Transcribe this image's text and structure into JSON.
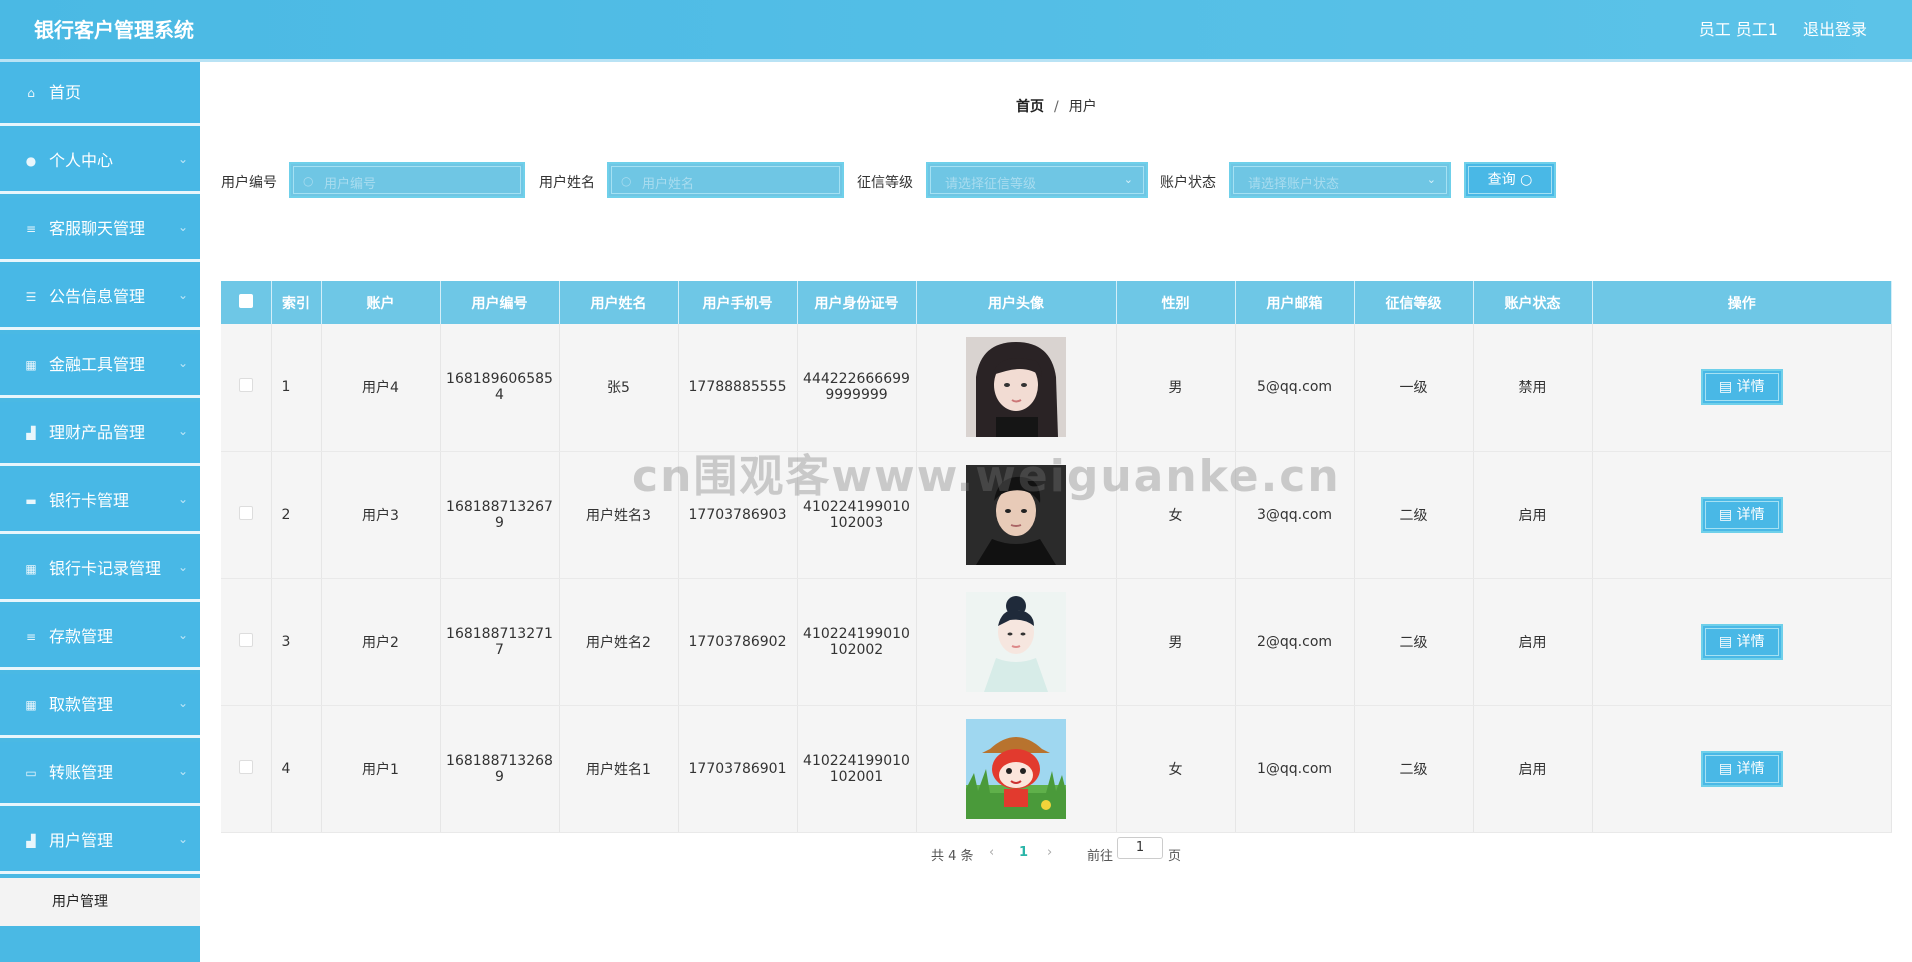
{
  "app": {
    "title": "银行客户管理系统",
    "user_label": "员工 员工1",
    "logout_label": "退出登录"
  },
  "sidebar": {
    "items": [
      {
        "label": "首页",
        "icon": "home-icon"
      },
      {
        "label": "个人中心",
        "icon": "user-icon"
      },
      {
        "label": "客服聊天管理",
        "icon": "menu-icon"
      },
      {
        "label": "公告信息管理",
        "icon": "sliders-icon"
      },
      {
        "label": "金融工具管理",
        "icon": "grid-icon"
      },
      {
        "label": "理财产品管理",
        "icon": "chart-icon"
      },
      {
        "label": "银行卡管理",
        "icon": "card-icon"
      },
      {
        "label": "银行卡记录管理",
        "icon": "grid-icon"
      },
      {
        "label": "存款管理",
        "icon": "menu-icon"
      },
      {
        "label": "取款管理",
        "icon": "grid-icon"
      },
      {
        "label": "转账管理",
        "icon": "monitor-icon"
      },
      {
        "label": "用户管理",
        "icon": "chart-icon"
      }
    ],
    "sub_item": "用户管理"
  },
  "breadcrumb": {
    "home": "首页",
    "sep": "/",
    "current": "用户"
  },
  "search": {
    "user_no_label": "用户编号",
    "user_no_placeholder": "用户编号",
    "user_name_label": "用户姓名",
    "user_name_placeholder": "用户姓名",
    "credit_label": "征信等级",
    "credit_placeholder": "请选择征信等级",
    "status_label": "账户状态",
    "status_placeholder": "请选择账户状态",
    "query_label": "查询"
  },
  "table": {
    "headers": [
      "索引",
      "账户",
      "用户编号",
      "用户姓名",
      "用户手机号",
      "用户身份证号",
      "用户头像",
      "性别",
      "用户邮箱",
      "征信等级",
      "账户状态",
      "操作"
    ],
    "detail_label": "详情",
    "rows": [
      {
        "index": "1",
        "account": "用户4",
        "user_no_1": "168189606585",
        "user_no_2": "4",
        "name": "张5",
        "phone": "17788885555",
        "id_1": "444222666699",
        "id_2": "9999999",
        "gender": "男",
        "email": "5@qq.com",
        "credit": "一级",
        "status": "禁用"
      },
      {
        "index": "2",
        "account": "用户3",
        "user_no_1": "168188713267",
        "user_no_2": "9",
        "name": "用户姓名3",
        "phone": "17703786903",
        "id_1": "410224199010",
        "id_2": "102003",
        "gender": "女",
        "email": "3@qq.com",
        "credit": "二级",
        "status": "启用"
      },
      {
        "index": "3",
        "account": "用户2",
        "user_no_1": "168188713271",
        "user_no_2": "7",
        "name": "用户姓名2",
        "phone": "17703786902",
        "id_1": "410224199010",
        "id_2": "102002",
        "gender": "男",
        "email": "2@qq.com",
        "credit": "二级",
        "status": "启用"
      },
      {
        "index": "4",
        "account": "用户1",
        "user_no_1": "168188713268",
        "user_no_2": "9",
        "name": "用户姓名1",
        "phone": "17703786901",
        "id_1": "410224199010",
        "id_2": "102001",
        "gender": "女",
        "email": "1@qq.com",
        "credit": "二级",
        "status": "启用"
      }
    ]
  },
  "pagination": {
    "total": "共 4 条",
    "prev": "‹",
    "page": "1",
    "next": "›",
    "goto_label": "前往",
    "goto_value": "1",
    "page_suffix": "页"
  },
  "watermark": "cn围观客www.weiguanke.cn"
}
